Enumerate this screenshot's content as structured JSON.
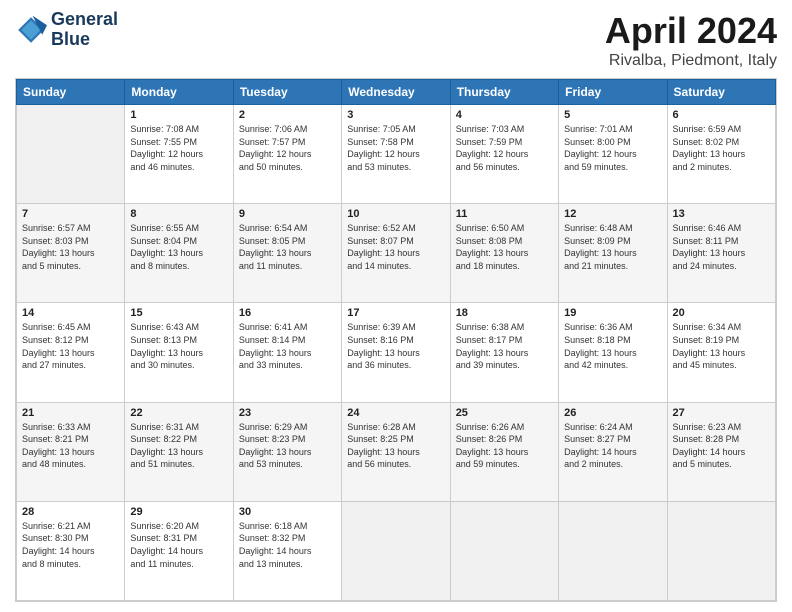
{
  "header": {
    "logo_line1": "General",
    "logo_line2": "Blue",
    "title": "April 2024",
    "subtitle": "Rivalba, Piedmont, Italy"
  },
  "calendar": {
    "columns": [
      "Sunday",
      "Monday",
      "Tuesday",
      "Wednesday",
      "Thursday",
      "Friday",
      "Saturday"
    ],
    "weeks": [
      [
        {
          "num": "",
          "info": ""
        },
        {
          "num": "1",
          "info": "Sunrise: 7:08 AM\nSunset: 7:55 PM\nDaylight: 12 hours\nand 46 minutes."
        },
        {
          "num": "2",
          "info": "Sunrise: 7:06 AM\nSunset: 7:57 PM\nDaylight: 12 hours\nand 50 minutes."
        },
        {
          "num": "3",
          "info": "Sunrise: 7:05 AM\nSunset: 7:58 PM\nDaylight: 12 hours\nand 53 minutes."
        },
        {
          "num": "4",
          "info": "Sunrise: 7:03 AM\nSunset: 7:59 PM\nDaylight: 12 hours\nand 56 minutes."
        },
        {
          "num": "5",
          "info": "Sunrise: 7:01 AM\nSunset: 8:00 PM\nDaylight: 12 hours\nand 59 minutes."
        },
        {
          "num": "6",
          "info": "Sunrise: 6:59 AM\nSunset: 8:02 PM\nDaylight: 13 hours\nand 2 minutes."
        }
      ],
      [
        {
          "num": "7",
          "info": "Sunrise: 6:57 AM\nSunset: 8:03 PM\nDaylight: 13 hours\nand 5 minutes."
        },
        {
          "num": "8",
          "info": "Sunrise: 6:55 AM\nSunset: 8:04 PM\nDaylight: 13 hours\nand 8 minutes."
        },
        {
          "num": "9",
          "info": "Sunrise: 6:54 AM\nSunset: 8:05 PM\nDaylight: 13 hours\nand 11 minutes."
        },
        {
          "num": "10",
          "info": "Sunrise: 6:52 AM\nSunset: 8:07 PM\nDaylight: 13 hours\nand 14 minutes."
        },
        {
          "num": "11",
          "info": "Sunrise: 6:50 AM\nSunset: 8:08 PM\nDaylight: 13 hours\nand 18 minutes."
        },
        {
          "num": "12",
          "info": "Sunrise: 6:48 AM\nSunset: 8:09 PM\nDaylight: 13 hours\nand 21 minutes."
        },
        {
          "num": "13",
          "info": "Sunrise: 6:46 AM\nSunset: 8:11 PM\nDaylight: 13 hours\nand 24 minutes."
        }
      ],
      [
        {
          "num": "14",
          "info": "Sunrise: 6:45 AM\nSunset: 8:12 PM\nDaylight: 13 hours\nand 27 minutes."
        },
        {
          "num": "15",
          "info": "Sunrise: 6:43 AM\nSunset: 8:13 PM\nDaylight: 13 hours\nand 30 minutes."
        },
        {
          "num": "16",
          "info": "Sunrise: 6:41 AM\nSunset: 8:14 PM\nDaylight: 13 hours\nand 33 minutes."
        },
        {
          "num": "17",
          "info": "Sunrise: 6:39 AM\nSunset: 8:16 PM\nDaylight: 13 hours\nand 36 minutes."
        },
        {
          "num": "18",
          "info": "Sunrise: 6:38 AM\nSunset: 8:17 PM\nDaylight: 13 hours\nand 39 minutes."
        },
        {
          "num": "19",
          "info": "Sunrise: 6:36 AM\nSunset: 8:18 PM\nDaylight: 13 hours\nand 42 minutes."
        },
        {
          "num": "20",
          "info": "Sunrise: 6:34 AM\nSunset: 8:19 PM\nDaylight: 13 hours\nand 45 minutes."
        }
      ],
      [
        {
          "num": "21",
          "info": "Sunrise: 6:33 AM\nSunset: 8:21 PM\nDaylight: 13 hours\nand 48 minutes."
        },
        {
          "num": "22",
          "info": "Sunrise: 6:31 AM\nSunset: 8:22 PM\nDaylight: 13 hours\nand 51 minutes."
        },
        {
          "num": "23",
          "info": "Sunrise: 6:29 AM\nSunset: 8:23 PM\nDaylight: 13 hours\nand 53 minutes."
        },
        {
          "num": "24",
          "info": "Sunrise: 6:28 AM\nSunset: 8:25 PM\nDaylight: 13 hours\nand 56 minutes."
        },
        {
          "num": "25",
          "info": "Sunrise: 6:26 AM\nSunset: 8:26 PM\nDaylight: 13 hours\nand 59 minutes."
        },
        {
          "num": "26",
          "info": "Sunrise: 6:24 AM\nSunset: 8:27 PM\nDaylight: 14 hours\nand 2 minutes."
        },
        {
          "num": "27",
          "info": "Sunrise: 6:23 AM\nSunset: 8:28 PM\nDaylight: 14 hours\nand 5 minutes."
        }
      ],
      [
        {
          "num": "28",
          "info": "Sunrise: 6:21 AM\nSunset: 8:30 PM\nDaylight: 14 hours\nand 8 minutes."
        },
        {
          "num": "29",
          "info": "Sunrise: 6:20 AM\nSunset: 8:31 PM\nDaylight: 14 hours\nand 11 minutes."
        },
        {
          "num": "30",
          "info": "Sunrise: 6:18 AM\nSunset: 8:32 PM\nDaylight: 14 hours\nand 13 minutes."
        },
        {
          "num": "",
          "info": ""
        },
        {
          "num": "",
          "info": ""
        },
        {
          "num": "",
          "info": ""
        },
        {
          "num": "",
          "info": ""
        }
      ]
    ]
  }
}
